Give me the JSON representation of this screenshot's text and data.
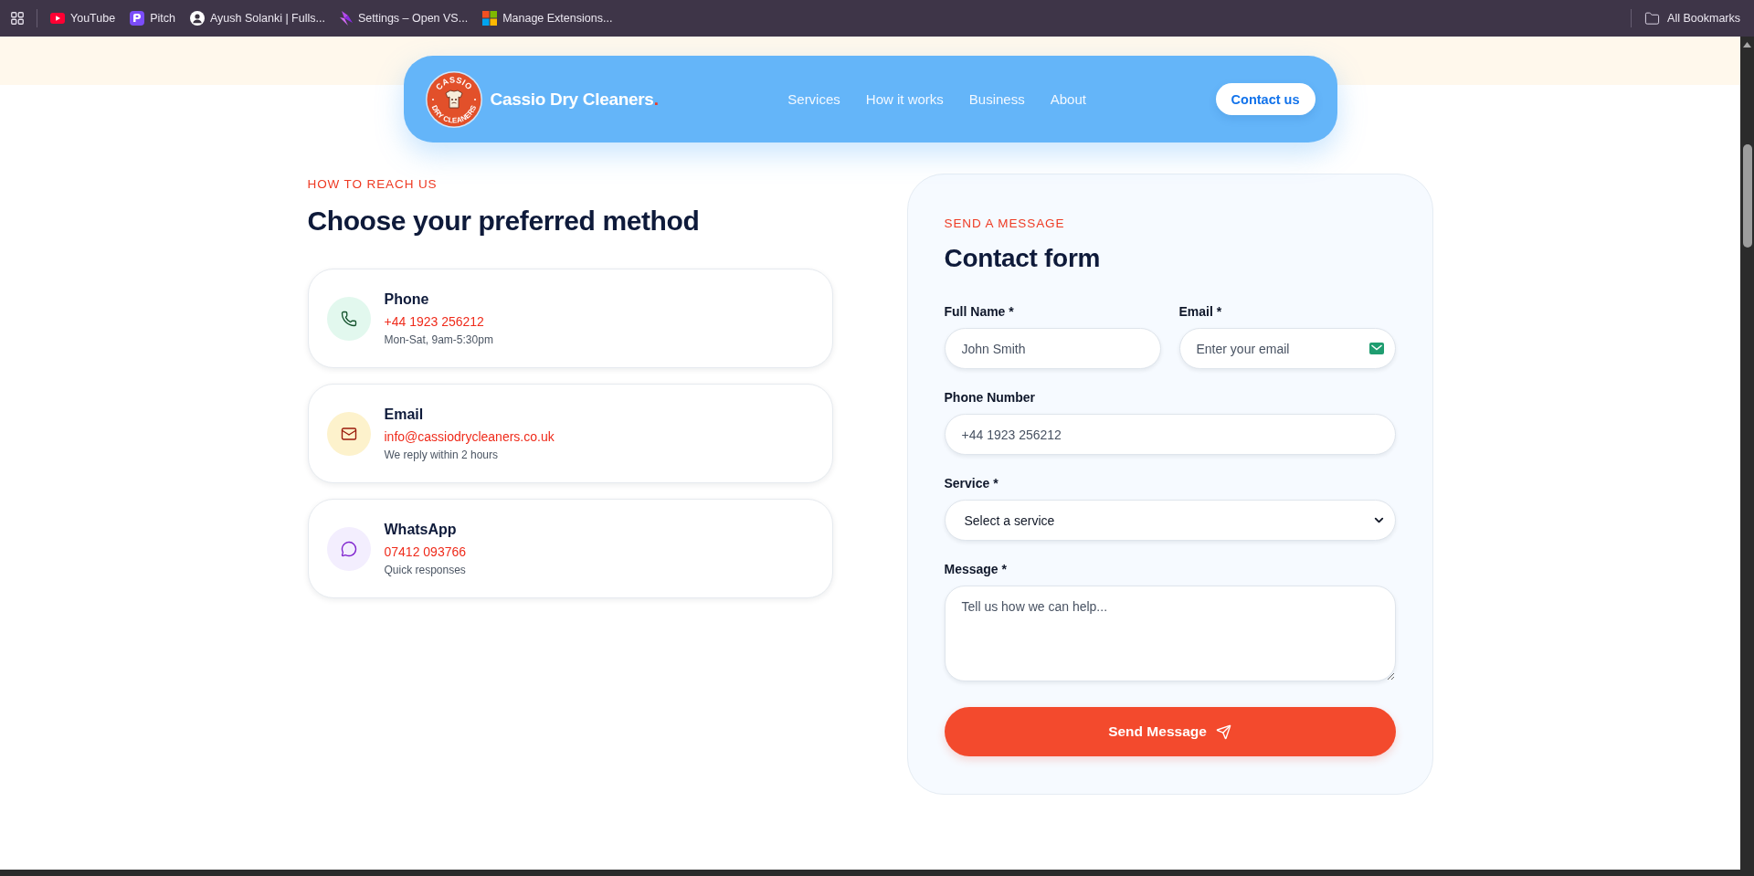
{
  "browser": {
    "bookmarks": [
      {
        "label": "YouTube",
        "kind": "play"
      },
      {
        "label": "Pitch",
        "kind": "app"
      },
      {
        "label": "Ayush Solanki | Fulls...",
        "kind": "avatar"
      },
      {
        "label": "Settings – Open VS...",
        "kind": "prism"
      },
      {
        "label": "Manage Extensions...",
        "kind": "tiles"
      }
    ],
    "all_bookmarks": "All Bookmarks"
  },
  "navbar": {
    "logo": {
      "top_text": "CASSIO",
      "bottom_text": "DRY CLEANERS"
    },
    "brand": {
      "name": "Cassio Dry Cleaners",
      "dot": "."
    },
    "links": [
      "Services",
      "How it works",
      "Business",
      "About"
    ],
    "cta": "Contact us"
  },
  "reach": {
    "eyebrow": "HOW TO REACH US",
    "title": "Choose your preferred method",
    "methods": [
      {
        "kind": "phone",
        "title": "Phone",
        "value": "+44 1923 256212",
        "note": "Mon-Sat, 9am-5:30pm"
      },
      {
        "kind": "email",
        "title": "Email",
        "value": "info@cassiodrycleaners.co.uk",
        "note": "We reply within 2 hours"
      },
      {
        "kind": "whatsapp",
        "title": "WhatsApp",
        "value": "07412 093766",
        "note": "Quick responses"
      }
    ]
  },
  "form": {
    "eyebrow": "SEND A MESSAGE",
    "title": "Contact form",
    "rows": [
      [
        {
          "kind": "text",
          "label": "Full Name *",
          "placeholder": "John Smith"
        },
        {
          "kind": "email",
          "label": "Email *",
          "placeholder": "Enter your email"
        }
      ],
      [
        {
          "kind": "text",
          "label": "Phone Number",
          "placeholder": "+44 1923 256212"
        }
      ],
      [
        {
          "kind": "select",
          "label": "Service *",
          "value": "Select a service"
        }
      ],
      [
        {
          "kind": "textarea",
          "label": "Message *",
          "placeholder": "Tell us how we can help..."
        }
      ]
    ],
    "submit": "Send Message"
  }
}
